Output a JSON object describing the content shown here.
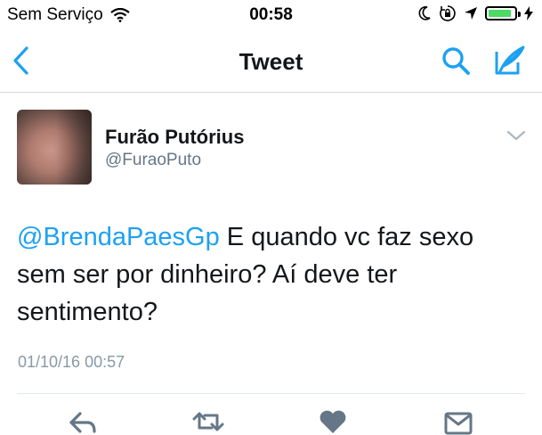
{
  "status_bar": {
    "carrier": "Sem Serviço",
    "time": "00:58",
    "battery_level": 0.9,
    "icons": [
      "wifi-icon",
      "moon-icon",
      "rotation-lock-icon",
      "location-icon",
      "battery-icon",
      "charging-icon"
    ]
  },
  "nav": {
    "title": "Tweet",
    "back_icon": "chevron-left-icon",
    "search_icon": "search-icon",
    "compose_icon": "compose-icon"
  },
  "tweet": {
    "author_name": "Furão Putórius",
    "author_handle": "@FuraoPuto",
    "mention": "@BrendaPaesGp",
    "text": " E quando vc faz sexo sem ser por dinheiro? Aí deve ter sentimento?",
    "timestamp": "01/10/16 00:57"
  },
  "actions": [
    "reply-icon",
    "retweet-icon",
    "like-icon",
    "message-icon"
  ],
  "colors": {
    "accent": "#1da1f2",
    "text": "#14171a",
    "secondary": "#657786",
    "battery": "#4cd964"
  }
}
